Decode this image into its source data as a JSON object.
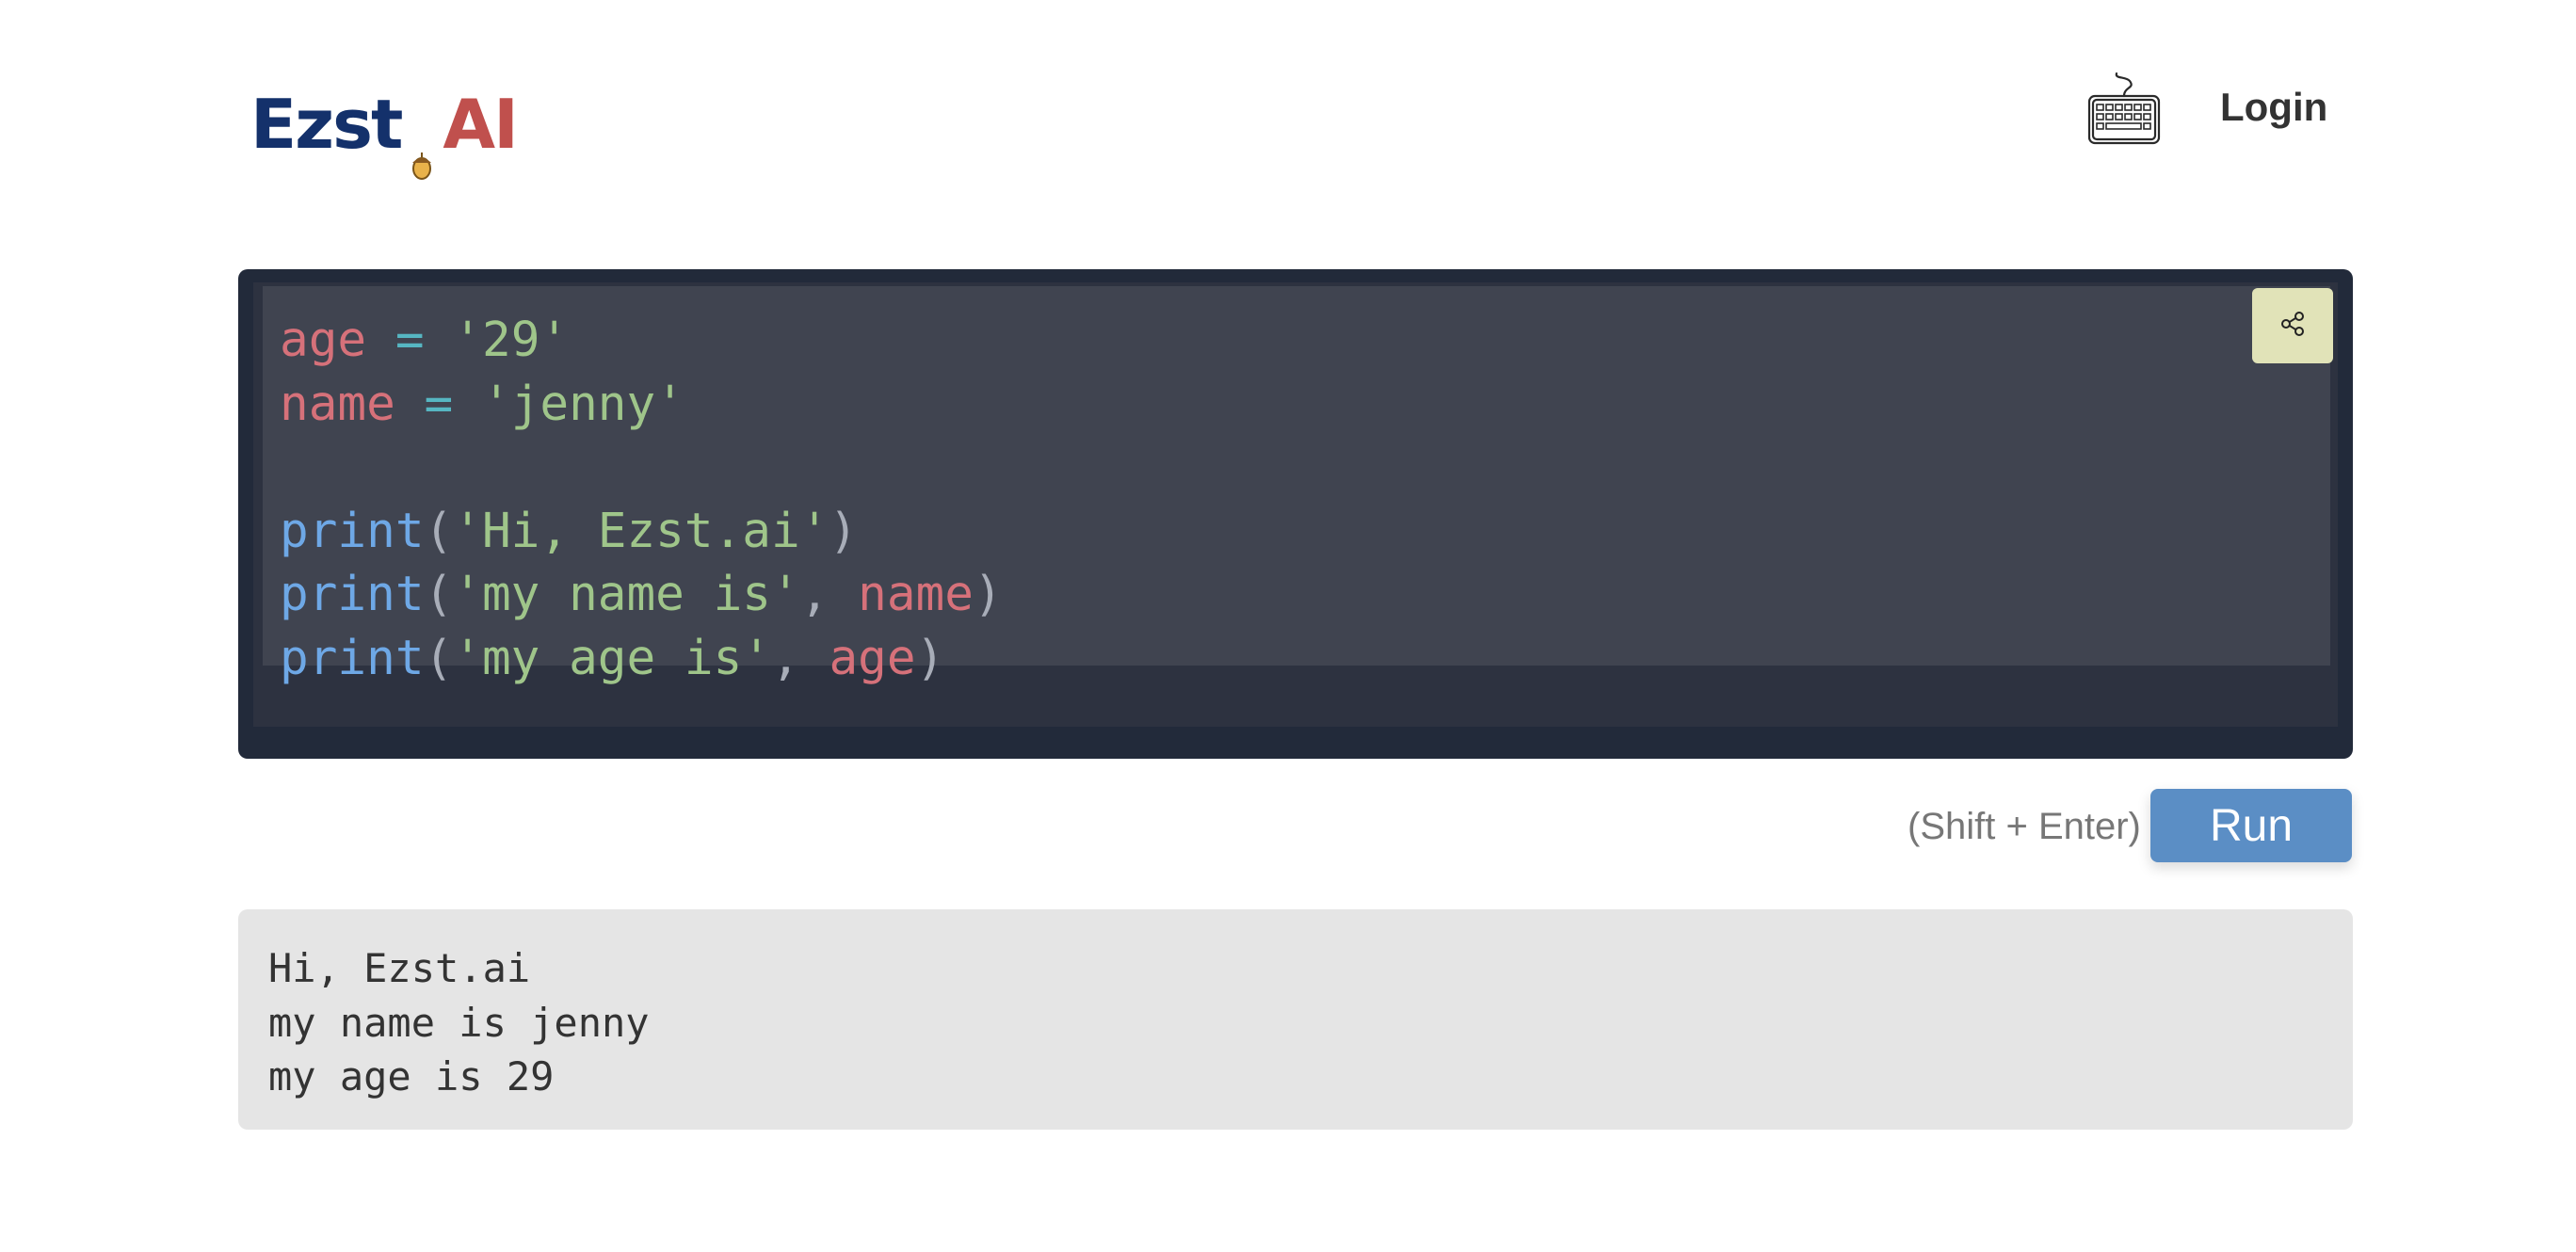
{
  "header": {
    "logo_part1": "Ezst",
    "logo_part2": "AI",
    "keyboard_icon": "keyboard-icon",
    "login_label": "Login"
  },
  "editor": {
    "code_lines": [
      [
        {
          "t": "age",
          "k": "var"
        },
        {
          "t": " ",
          "k": "pun"
        },
        {
          "t": "=",
          "k": "op"
        },
        {
          "t": " ",
          "k": "pun"
        },
        {
          "t": "'29'",
          "k": "str"
        }
      ],
      [
        {
          "t": "name",
          "k": "var"
        },
        {
          "t": " ",
          "k": "pun"
        },
        {
          "t": "=",
          "k": "op"
        },
        {
          "t": " ",
          "k": "pun"
        },
        {
          "t": "'jenny'",
          "k": "str"
        }
      ],
      [],
      [
        {
          "t": "print",
          "k": "fn"
        },
        {
          "t": "(",
          "k": "pun"
        },
        {
          "t": "'Hi, Ezst.ai'",
          "k": "str"
        },
        {
          "t": ")",
          "k": "pun"
        }
      ],
      [
        {
          "t": "print",
          "k": "fn"
        },
        {
          "t": "(",
          "k": "pun"
        },
        {
          "t": "'my name is'",
          "k": "str"
        },
        {
          "t": ", ",
          "k": "pun"
        },
        {
          "t": "name",
          "k": "var"
        },
        {
          "t": ")",
          "k": "pun"
        }
      ],
      [
        {
          "t": "print",
          "k": "fn"
        },
        {
          "t": "(",
          "k": "pun"
        },
        {
          "t": "'my age is'",
          "k": "str"
        },
        {
          "t": ", ",
          "k": "pun"
        },
        {
          "t": "age",
          "k": "var"
        },
        {
          "t": ")",
          "k": "pun"
        }
      ]
    ],
    "share_icon": "share-icon"
  },
  "run": {
    "hint": "(Shift + Enter)",
    "label": "Run"
  },
  "output": {
    "lines": [
      "Hi, Ezst.ai",
      "my name is jenny",
      "my age is 29"
    ]
  },
  "colors": {
    "editor_bg": "#222a3a",
    "editor_selection": "#404450",
    "run_button": "#5b8ec5",
    "share_button": "#e1e3b8",
    "output_bg": "#e5e5e5",
    "logo_blue": "#14316b",
    "logo_red": "#c0504d"
  }
}
